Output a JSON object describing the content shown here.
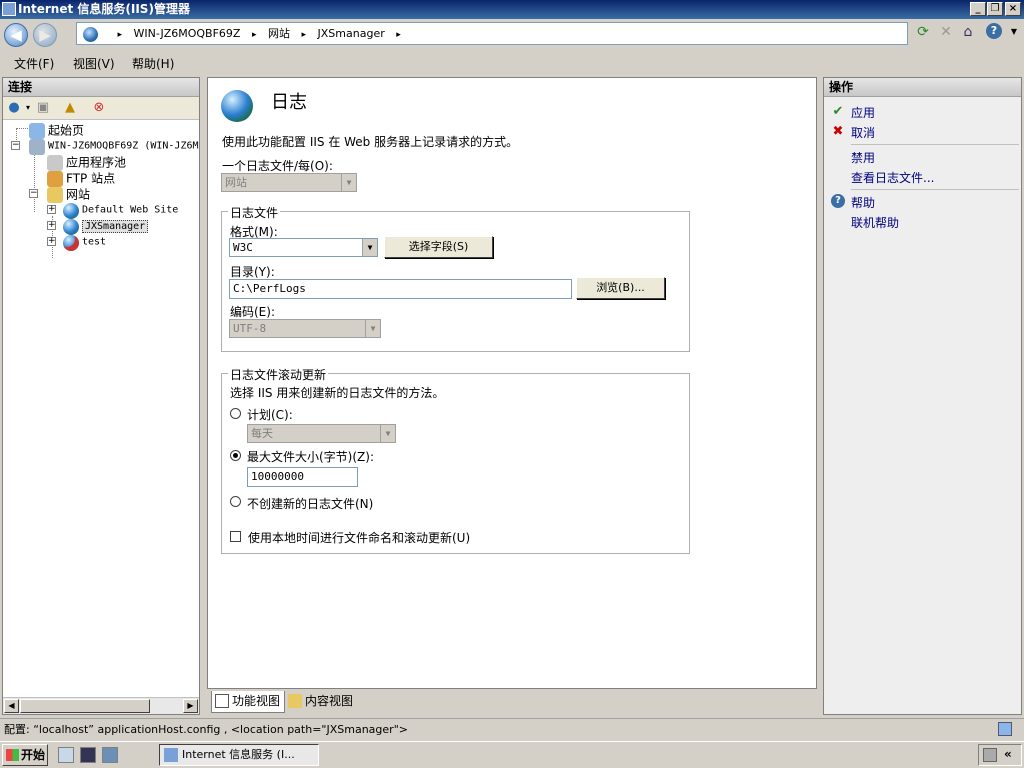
{
  "window": {
    "title": "Internet 信息服务(IIS)管理器",
    "minimize": "_",
    "restore": "❐",
    "close": "×"
  },
  "address": {
    "segments": [
      "WIN-JZ6MOQBF69Z",
      "网站",
      "JXSmanager"
    ],
    "separator": "▸",
    "back": "◀",
    "forward": "▶"
  },
  "toolbar_icons": [
    "refresh-icon",
    "stop-icon",
    "home-icon",
    "help-icon"
  ],
  "menu": {
    "file": "文件(F)",
    "view": "视图(V)",
    "help": "帮助(H)"
  },
  "connections": {
    "title": "连接",
    "tree": {
      "start_page": "起始页",
      "server": "WIN-JZ6MOQBF69Z (WIN-JZ6MO",
      "app_pools": "应用程序池",
      "ftp_sites": "FTP 站点",
      "sites": "网站",
      "default_site": "Default Web Site",
      "jxsmanager": "JXSmanager",
      "test": "test"
    }
  },
  "main": {
    "title": "日志",
    "description": "使用此功能配置 IIS 在 Web 服务器上记录请求的方式。",
    "one_log_label": "一个日志文件/每(O):",
    "one_log_value": "网站",
    "log_file_group": "日志文件",
    "format_label": "格式(M):",
    "format_value": "W3C",
    "select_fields_button": "选择字段(S)",
    "directory_label": "目录(Y):",
    "directory_value": "C:\\PerfLogs",
    "browse_button": "浏览(B)...",
    "encoding_label": "编码(E):",
    "encoding_value": "UTF-8",
    "rollover_group": "日志文件滚动更新",
    "rollover_desc": "选择 IIS 用来创建新的日志文件的方法。",
    "schedule_label": "计划(C):",
    "schedule_value": "每天",
    "max_size_label": "最大文件大小(字节)(Z):",
    "max_size_value": "10000000",
    "no_new_file_label": "不创建新的日志文件(N)",
    "local_time_label": "使用本地时间进行文件命名和滚动更新(U)"
  },
  "view_tabs": {
    "features": "功能视图",
    "content": "内容视图"
  },
  "actions": {
    "title": "操作",
    "apply": "应用",
    "cancel": "取消",
    "disable": "禁用",
    "view_logs": "查看日志文件...",
    "help": "帮助",
    "online_help": "联机帮助"
  },
  "status": {
    "text": "配置: “localhost” applicationHost.config , <location path=\"JXSmanager\">"
  },
  "taskbar": {
    "start": "开始",
    "task_item": "Internet 信息服务 (I..."
  }
}
